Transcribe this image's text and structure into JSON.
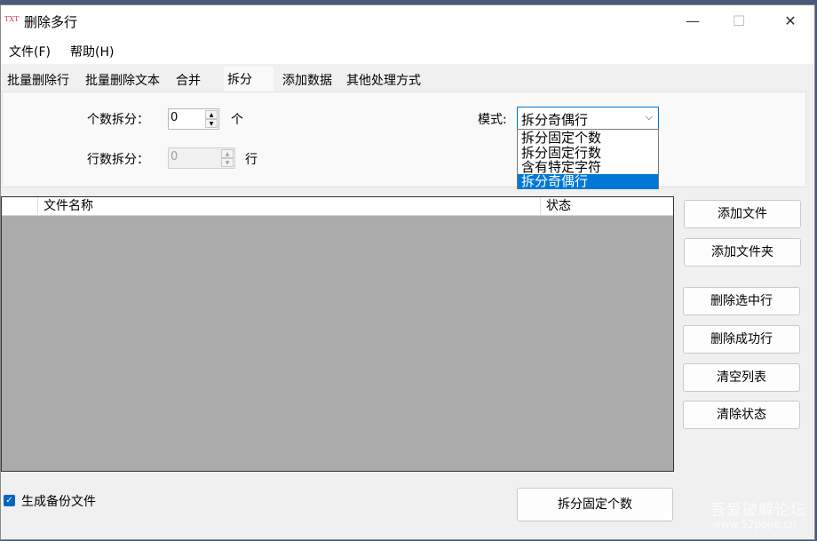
{
  "window": {
    "title": "删除多行",
    "app_icon": "TXT",
    "controls": {
      "minimize": "—",
      "maximize": "☐",
      "close": "✕"
    }
  },
  "menu": [
    "文件(F)",
    "帮助(H)"
  ],
  "tabs": [
    {
      "label": "批量删除行",
      "active": false
    },
    {
      "label": "批量删除文本",
      "active": false
    },
    {
      "label": "合并",
      "active": false
    },
    {
      "label": "拆分",
      "active": true
    },
    {
      "label": "添加数据",
      "active": false
    },
    {
      "label": "其他处理方式",
      "active": false
    }
  ],
  "split_panel": {
    "count_label": "个数拆分：",
    "count_value": "0",
    "count_unit": "个",
    "rows_label": "行数拆分：",
    "rows_value": "0",
    "rows_unit": "行",
    "mode_label": "模式:",
    "mode_value": "拆分奇偶行",
    "mode_options": [
      "拆分固定个数",
      "拆分固定行数",
      "含有特定字符",
      "拆分奇偶行"
    ],
    "selected_option_index": 3
  },
  "file_list": {
    "columns": [
      "",
      "文件名称",
      "状态"
    ],
    "rows": []
  },
  "side_buttons": [
    "添加文件",
    "添加文件夹",
    "删除选中行",
    "删除成功行",
    "清空列表",
    "清除状态"
  ],
  "backup": {
    "label": "生成备份文件",
    "checked": true
  },
  "action_button": "拆分固定个数",
  "watermark": {
    "line1": "吾爱破解论坛",
    "line2": "www.52pojie.cn"
  },
  "colors": {
    "accent": "#0078d7",
    "list_bg": "#ababab",
    "window_bg": "#f0f0f0"
  }
}
